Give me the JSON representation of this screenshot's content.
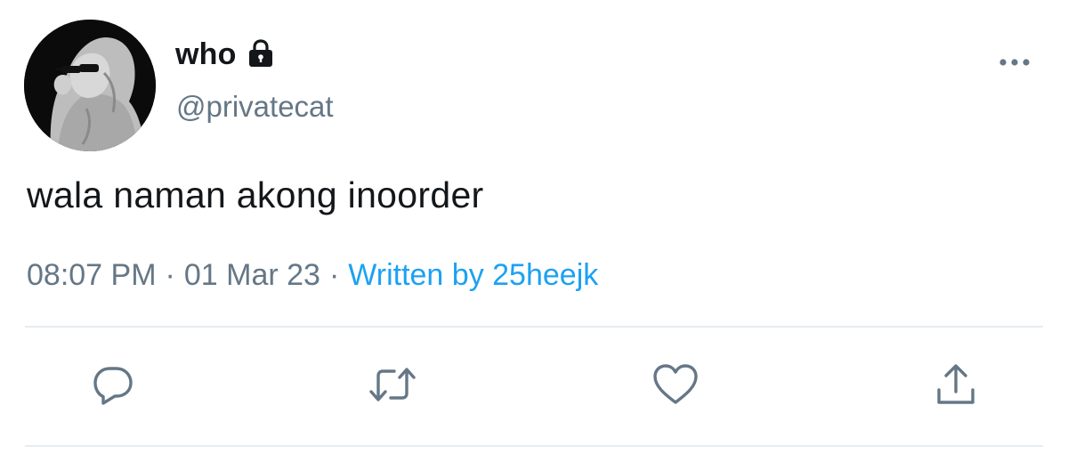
{
  "tweet": {
    "author": {
      "display_name": "who",
      "handle": "@privatecat",
      "avatar": "avatar",
      "protected_icon": "lock-icon"
    },
    "text": "wala naman akong inoorder",
    "meta": {
      "time": "08:07 PM",
      "separator": "·",
      "date": "01 Mar 23",
      "source": "Written by 25heejk"
    },
    "actions": [
      {
        "name": "reply",
        "icon": "speech-bubble-icon"
      },
      {
        "name": "retweet",
        "icon": "retweet-icon"
      },
      {
        "name": "like",
        "icon": "heart-icon"
      },
      {
        "name": "share",
        "icon": "share-upload-icon"
      }
    ],
    "more_menu_icon": "more-dots-icon",
    "colors": {
      "text": "#14171a",
      "secondary": "#657786",
      "link": "#1da1f2",
      "divider": "#e6ecf0"
    }
  }
}
